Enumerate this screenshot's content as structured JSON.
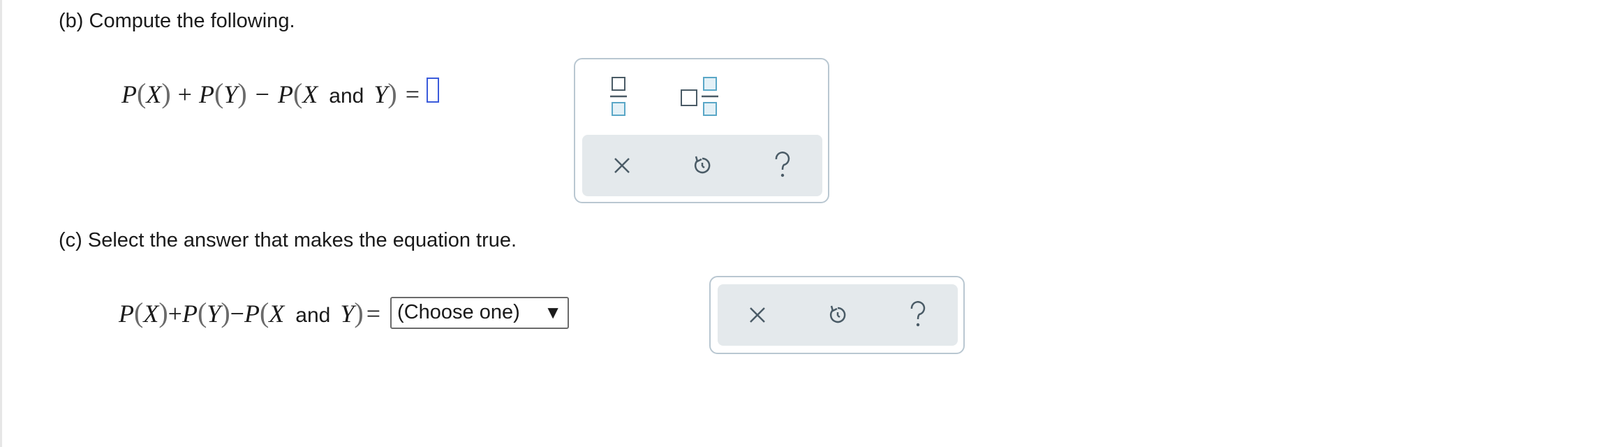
{
  "part_b": {
    "prompt": "(b) Compute the following.",
    "equation": {
      "p1": "P",
      "x1": "X",
      "plus": "+",
      "p2": "P",
      "y1": "Y",
      "minus": "−",
      "p3": "P",
      "x2": "X",
      "and": "and",
      "y2": "Y",
      "equals": "="
    }
  },
  "part_c": {
    "prompt": "(c) Select the answer that makes the equation true.",
    "equation": {
      "p1": "P",
      "x1": "X",
      "plus": "+",
      "p2": "P",
      "y1": "Y",
      "minus": "−",
      "p3": "P",
      "x2": "X",
      "and": "and",
      "y2": "Y",
      "equals": "="
    },
    "select": {
      "value": "(Choose one)",
      "arrow": "▼"
    }
  },
  "icons": {
    "fraction": "fraction-icon",
    "mixed_number": "mixed-number-icon",
    "clear": "x-icon",
    "undo": "undo-icon",
    "help": "help-icon"
  },
  "colors": {
    "panel_border": "#b9c7d1",
    "toolbar_bg": "#e4e9ec",
    "icon_color": "#4a5b66",
    "template_box": "#5aa7c7",
    "answer_focus": "#3b5bdb"
  }
}
